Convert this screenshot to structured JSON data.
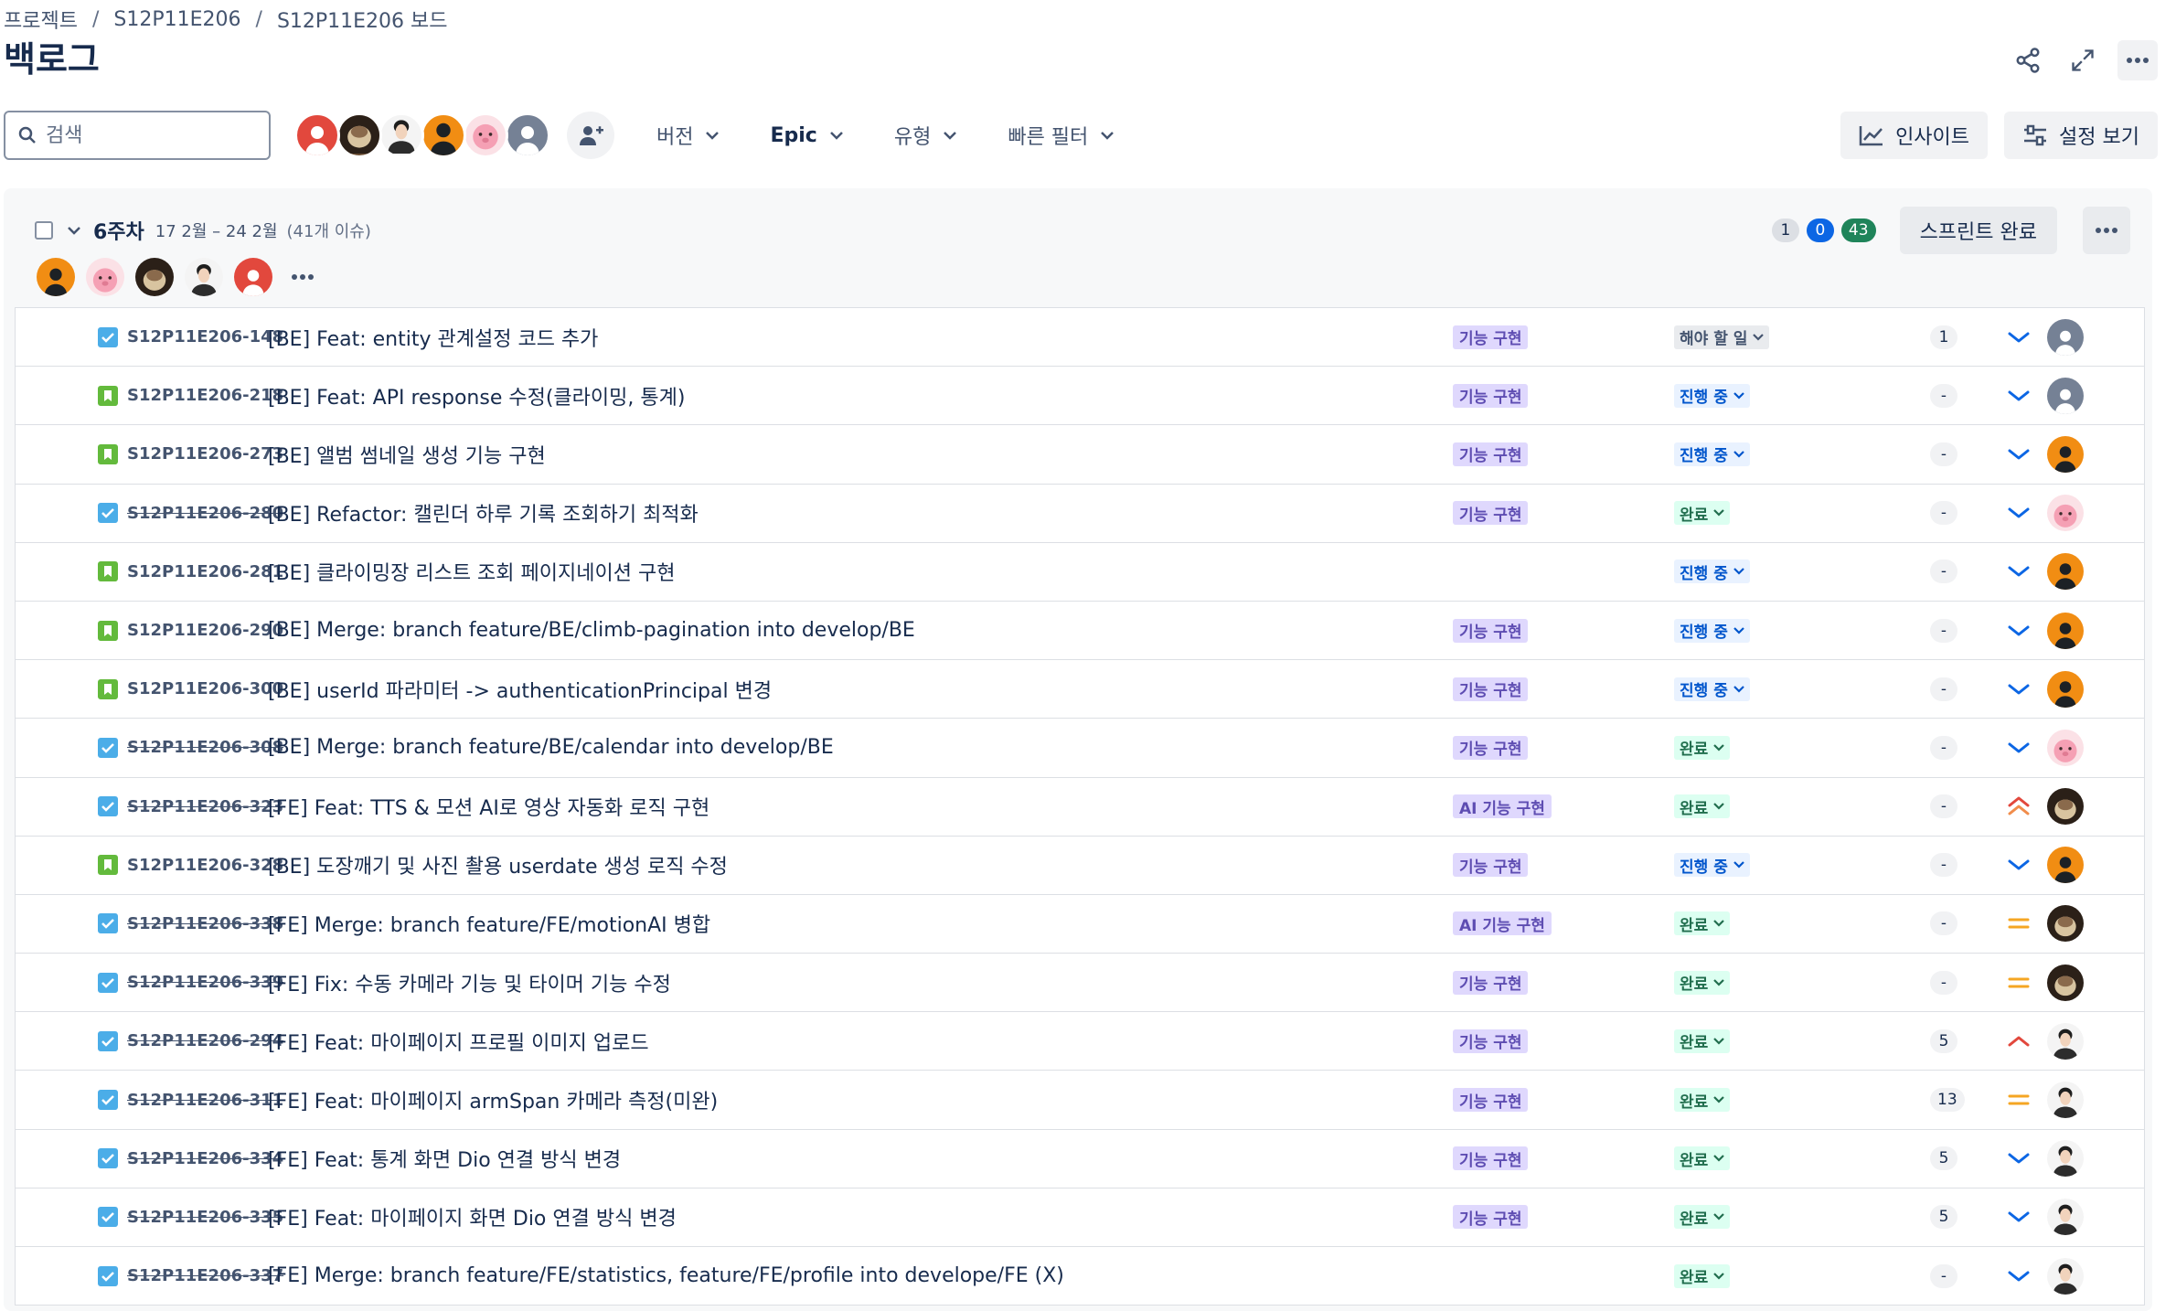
{
  "breadcrumb": [
    "프로젝트",
    "S12P11E206",
    "S12P11E206 보드"
  ],
  "page_title": "백로그",
  "search": {
    "placeholder": "검색",
    "value": ""
  },
  "filters": [
    {
      "label": "버전",
      "bold": false
    },
    {
      "label": "Epic",
      "bold": true
    },
    {
      "label": "유형",
      "bold": false
    },
    {
      "label": "빠른 필터",
      "bold": false
    }
  ],
  "buttons": {
    "insight": "인사이트",
    "view_settings": "설정 보기"
  },
  "sprint": {
    "name": "6주차",
    "dates": "17 2월 – 24 2월",
    "issue_count": "(41개 이슈)",
    "todo_count": "1",
    "progress_count": "0",
    "done_count": "43",
    "complete_label": "스프린트 완료"
  },
  "issues": [
    {
      "type": "task",
      "key": "S12P11E206-148",
      "summary": "[BE] Feat: entity 관계설정 코드 추가",
      "epic": "기능 구현",
      "status": "해야 할 일",
      "status_kind": "todo",
      "points": "1",
      "priority": "low",
      "assignee": "grey"
    },
    {
      "type": "story",
      "key": "S12P11E206-218",
      "summary": "[BE] Feat: API response 수정(클라이밍, 통계)",
      "epic": "기능 구현",
      "status": "진행 중",
      "status_kind": "prog",
      "points": "-",
      "priority": "low",
      "assignee": "grey"
    },
    {
      "type": "story",
      "key": "S12P11E206-273",
      "summary": "[BE] 앨범 썸네일 생성 기능 구현",
      "epic": "기능 구현",
      "status": "진행 중",
      "status_kind": "prog",
      "points": "-",
      "priority": "low",
      "assignee": "orange"
    },
    {
      "type": "task",
      "key": "S12P11E206-280",
      "summary": "[BE] Refactor: 캘린더 하루 기록 조회하기 최적화",
      "epic": "기능 구현",
      "status": "완료",
      "status_kind": "done",
      "points": "-",
      "priority": "low",
      "assignee": "pink"
    },
    {
      "type": "story",
      "key": "S12P11E206-281",
      "summary": "[BE] 클라이밍장 리스트 조회 페이지네이션 구현",
      "epic": "",
      "status": "진행 중",
      "status_kind": "prog",
      "points": "-",
      "priority": "low",
      "assignee": "orange"
    },
    {
      "type": "story",
      "key": "S12P11E206-290",
      "summary": "[BE] Merge: branch feature/BE/climb-pagination into develop/BE",
      "epic": "기능 구현",
      "status": "진행 중",
      "status_kind": "prog",
      "points": "-",
      "priority": "low",
      "assignee": "orange"
    },
    {
      "type": "story",
      "key": "S12P11E206-300",
      "summary": "[BE] userId 파라미터 -> authenticationPrincipal 변경",
      "epic": "기능 구현",
      "status": "진행 중",
      "status_kind": "prog",
      "points": "-",
      "priority": "low",
      "assignee": "orange"
    },
    {
      "type": "task",
      "key": "S12P11E206-308",
      "summary": "[BE] Merge: branch feature/BE/calendar into develop/BE",
      "epic": "기능 구현",
      "status": "완료",
      "status_kind": "done",
      "points": "-",
      "priority": "low",
      "assignee": "pink"
    },
    {
      "type": "task",
      "key": "S12P11E206-323",
      "summary": "[FE] Feat: TTS & 모션 AI로 영상 자동화 로직 구현",
      "epic": "AI 기능 구현",
      "status": "완료",
      "status_kind": "done",
      "points": "-",
      "priority": "highest",
      "assignee": "dark"
    },
    {
      "type": "story",
      "key": "S12P11E206-328",
      "summary": "[BE] 도장깨기 및 사진 촬용 userdate 생성 로직 수정",
      "epic": "기능 구현",
      "status": "진행 중",
      "status_kind": "prog",
      "points": "-",
      "priority": "low",
      "assignee": "orange"
    },
    {
      "type": "task",
      "key": "S12P11E206-338",
      "summary": "[FE] Merge: branch feature/FE/motionAI 병합",
      "epic": "AI 기능 구현",
      "status": "완료",
      "status_kind": "done",
      "points": "-",
      "priority": "medium",
      "assignee": "dark"
    },
    {
      "type": "task",
      "key": "S12P11E206-339",
      "summary": "[FE] Fix: 수동 카메라 기능 및 타이머 기능 수정",
      "epic": "기능 구현",
      "status": "완료",
      "status_kind": "done",
      "points": "-",
      "priority": "medium",
      "assignee": "dark"
    },
    {
      "type": "task",
      "key": "S12P11E206-294",
      "summary": "[FE] Feat: 마이페이지 프로필 이미지 업로드",
      "epic": "기능 구현",
      "status": "완료",
      "status_kind": "done",
      "points": "5",
      "priority": "high",
      "assignee": "person"
    },
    {
      "type": "task",
      "key": "S12P11E206-311",
      "summary": "[FE] Feat: 마이페이지 armSpan 카메라 측정(미완)",
      "epic": "기능 구현",
      "status": "완료",
      "status_kind": "done",
      "points": "13",
      "priority": "medium",
      "assignee": "person"
    },
    {
      "type": "task",
      "key": "S12P11E206-334",
      "summary": "[FE] Feat: 통계 화면 Dio 연결 방식 변경",
      "epic": "기능 구현",
      "status": "완료",
      "status_kind": "done",
      "points": "5",
      "priority": "low",
      "assignee": "person"
    },
    {
      "type": "task",
      "key": "S12P11E206-335",
      "summary": "[FE] Feat: 마이페이지 화면 Dio 연결 방식 변경",
      "epic": "기능 구현",
      "status": "완료",
      "status_kind": "done",
      "points": "5",
      "priority": "low",
      "assignee": "person"
    },
    {
      "type": "task",
      "key": "S12P11E206-337",
      "summary": "[FE] Merge: branch feature/FE/statistics, feature/FE/profile into develope/FE (X)",
      "epic": "",
      "status": "완료",
      "status_kind": "done",
      "points": "-",
      "priority": "low",
      "assignee": "person"
    }
  ],
  "colors": {
    "brand_blue": "#0c66e4",
    "done_green": "#1f845a",
    "epic_purple": "#5e4db2",
    "priority_low": "#0c66e4",
    "priority_medium": "#f5a623",
    "priority_high": "#e2483d"
  }
}
